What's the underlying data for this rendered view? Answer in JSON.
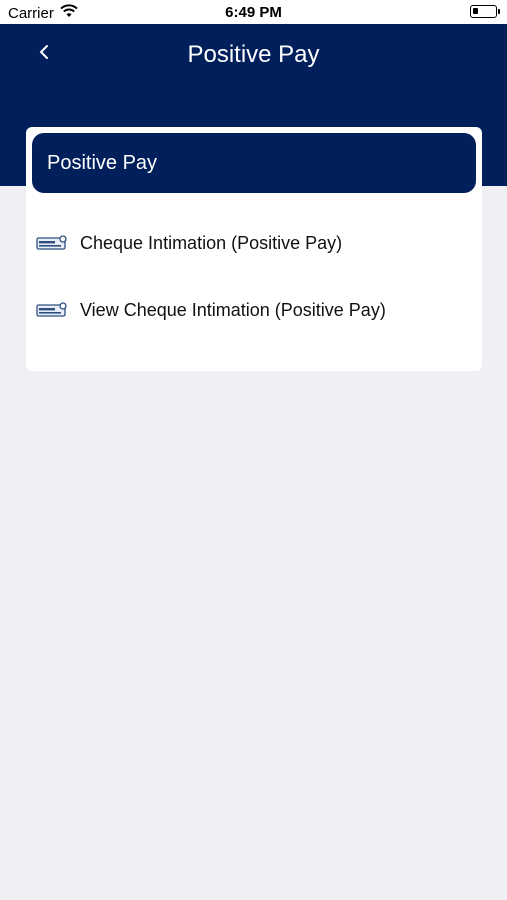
{
  "status_bar": {
    "carrier": "Carrier",
    "time": "6:49 PM",
    "wifi_icon": "wifi-icon",
    "battery_icon": "battery-icon"
  },
  "header": {
    "title": "Positive Pay",
    "back_icon": "chevron-left-icon",
    "background_color": "#001f5b"
  },
  "card": {
    "title": "Positive Pay",
    "items": [
      {
        "label": "Cheque Intimation (Positive Pay)",
        "icon": "cheque-icon"
      },
      {
        "label": "View Cheque Intimation (Positive Pay)",
        "icon": "cheque-icon"
      }
    ]
  },
  "colors": {
    "primary": "#001f5b",
    "background": "#efeff4",
    "card": "#ffffff"
  }
}
